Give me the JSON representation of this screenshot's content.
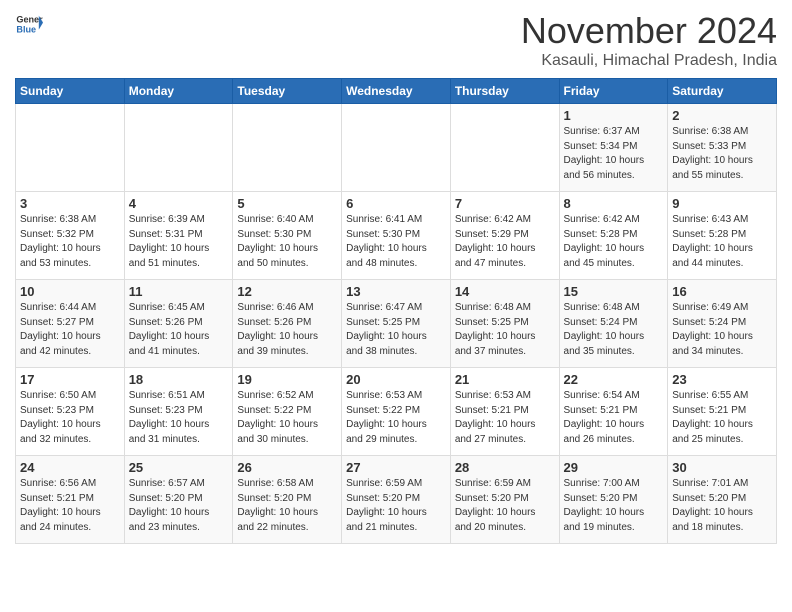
{
  "logo": {
    "line1": "General",
    "line2": "Blue"
  },
  "title": "November 2024",
  "location": "Kasauli, Himachal Pradesh, India",
  "weekdays": [
    "Sunday",
    "Monday",
    "Tuesday",
    "Wednesday",
    "Thursday",
    "Friday",
    "Saturday"
  ],
  "weeks": [
    [
      {
        "day": "",
        "info": ""
      },
      {
        "day": "",
        "info": ""
      },
      {
        "day": "",
        "info": ""
      },
      {
        "day": "",
        "info": ""
      },
      {
        "day": "",
        "info": ""
      },
      {
        "day": "1",
        "info": "Sunrise: 6:37 AM\nSunset: 5:34 PM\nDaylight: 10 hours and 56 minutes."
      },
      {
        "day": "2",
        "info": "Sunrise: 6:38 AM\nSunset: 5:33 PM\nDaylight: 10 hours and 55 minutes."
      }
    ],
    [
      {
        "day": "3",
        "info": "Sunrise: 6:38 AM\nSunset: 5:32 PM\nDaylight: 10 hours and 53 minutes."
      },
      {
        "day": "4",
        "info": "Sunrise: 6:39 AM\nSunset: 5:31 PM\nDaylight: 10 hours and 51 minutes."
      },
      {
        "day": "5",
        "info": "Sunrise: 6:40 AM\nSunset: 5:30 PM\nDaylight: 10 hours and 50 minutes."
      },
      {
        "day": "6",
        "info": "Sunrise: 6:41 AM\nSunset: 5:30 PM\nDaylight: 10 hours and 48 minutes."
      },
      {
        "day": "7",
        "info": "Sunrise: 6:42 AM\nSunset: 5:29 PM\nDaylight: 10 hours and 47 minutes."
      },
      {
        "day": "8",
        "info": "Sunrise: 6:42 AM\nSunset: 5:28 PM\nDaylight: 10 hours and 45 minutes."
      },
      {
        "day": "9",
        "info": "Sunrise: 6:43 AM\nSunset: 5:28 PM\nDaylight: 10 hours and 44 minutes."
      }
    ],
    [
      {
        "day": "10",
        "info": "Sunrise: 6:44 AM\nSunset: 5:27 PM\nDaylight: 10 hours and 42 minutes."
      },
      {
        "day": "11",
        "info": "Sunrise: 6:45 AM\nSunset: 5:26 PM\nDaylight: 10 hours and 41 minutes."
      },
      {
        "day": "12",
        "info": "Sunrise: 6:46 AM\nSunset: 5:26 PM\nDaylight: 10 hours and 39 minutes."
      },
      {
        "day": "13",
        "info": "Sunrise: 6:47 AM\nSunset: 5:25 PM\nDaylight: 10 hours and 38 minutes."
      },
      {
        "day": "14",
        "info": "Sunrise: 6:48 AM\nSunset: 5:25 PM\nDaylight: 10 hours and 37 minutes."
      },
      {
        "day": "15",
        "info": "Sunrise: 6:48 AM\nSunset: 5:24 PM\nDaylight: 10 hours and 35 minutes."
      },
      {
        "day": "16",
        "info": "Sunrise: 6:49 AM\nSunset: 5:24 PM\nDaylight: 10 hours and 34 minutes."
      }
    ],
    [
      {
        "day": "17",
        "info": "Sunrise: 6:50 AM\nSunset: 5:23 PM\nDaylight: 10 hours and 32 minutes."
      },
      {
        "day": "18",
        "info": "Sunrise: 6:51 AM\nSunset: 5:23 PM\nDaylight: 10 hours and 31 minutes."
      },
      {
        "day": "19",
        "info": "Sunrise: 6:52 AM\nSunset: 5:22 PM\nDaylight: 10 hours and 30 minutes."
      },
      {
        "day": "20",
        "info": "Sunrise: 6:53 AM\nSunset: 5:22 PM\nDaylight: 10 hours and 29 minutes."
      },
      {
        "day": "21",
        "info": "Sunrise: 6:53 AM\nSunset: 5:21 PM\nDaylight: 10 hours and 27 minutes."
      },
      {
        "day": "22",
        "info": "Sunrise: 6:54 AM\nSunset: 5:21 PM\nDaylight: 10 hours and 26 minutes."
      },
      {
        "day": "23",
        "info": "Sunrise: 6:55 AM\nSunset: 5:21 PM\nDaylight: 10 hours and 25 minutes."
      }
    ],
    [
      {
        "day": "24",
        "info": "Sunrise: 6:56 AM\nSunset: 5:21 PM\nDaylight: 10 hours and 24 minutes."
      },
      {
        "day": "25",
        "info": "Sunrise: 6:57 AM\nSunset: 5:20 PM\nDaylight: 10 hours and 23 minutes."
      },
      {
        "day": "26",
        "info": "Sunrise: 6:58 AM\nSunset: 5:20 PM\nDaylight: 10 hours and 22 minutes."
      },
      {
        "day": "27",
        "info": "Sunrise: 6:59 AM\nSunset: 5:20 PM\nDaylight: 10 hours and 21 minutes."
      },
      {
        "day": "28",
        "info": "Sunrise: 6:59 AM\nSunset: 5:20 PM\nDaylight: 10 hours and 20 minutes."
      },
      {
        "day": "29",
        "info": "Sunrise: 7:00 AM\nSunset: 5:20 PM\nDaylight: 10 hours and 19 minutes."
      },
      {
        "day": "30",
        "info": "Sunrise: 7:01 AM\nSunset: 5:20 PM\nDaylight: 10 hours and 18 minutes."
      }
    ]
  ]
}
